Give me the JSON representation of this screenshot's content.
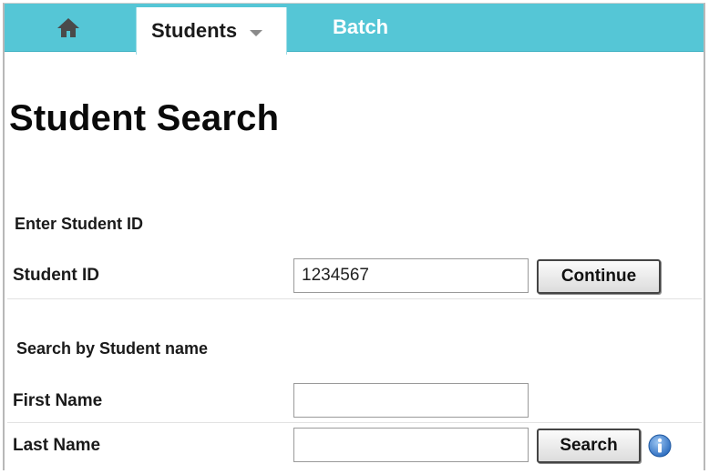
{
  "nav": {
    "home_icon": "home-icon",
    "tabs": [
      {
        "label": "Students",
        "active": true,
        "has_dropdown": true
      },
      {
        "label": "Batch",
        "active": false
      }
    ],
    "colors": {
      "bar": "#55c6d6",
      "active_tab": "#ffffff",
      "inactive_text": "#ffffff"
    }
  },
  "page": {
    "title": "Student Search"
  },
  "id_section": {
    "heading": "Enter Student ID",
    "label": "Student ID",
    "value": "1234567",
    "button": "Continue"
  },
  "name_section": {
    "heading": "Search by Student name",
    "first_name_label": "First Name",
    "first_name_value": "",
    "last_name_label": "Last Name",
    "last_name_value": "",
    "button": "Search",
    "info_icon": "info-icon"
  }
}
